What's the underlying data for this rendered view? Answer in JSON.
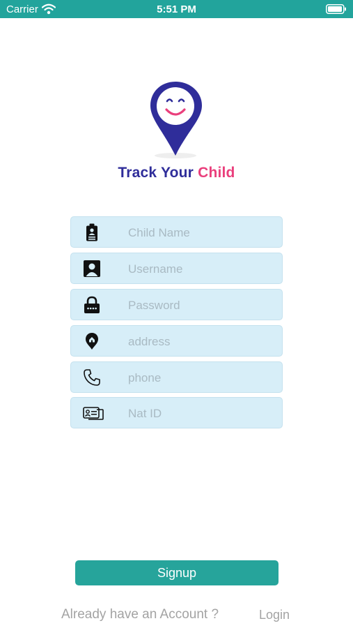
{
  "status_bar": {
    "carrier": "Carrier",
    "time": "5:51 PM",
    "icons": [
      "wifi-icon",
      "battery-icon"
    ]
  },
  "brand": {
    "title_part1": "Track Your",
    "title_part2": "Child",
    "colors": {
      "primary": "#2f2d9a",
      "accent": "#ea3f7c"
    }
  },
  "form": {
    "fields": [
      {
        "icon": "id-badge-icon",
        "placeholder": "Child Name",
        "value": ""
      },
      {
        "icon": "user-icon",
        "placeholder": "Username",
        "value": ""
      },
      {
        "icon": "lock-icon",
        "placeholder": "Password",
        "value": ""
      },
      {
        "icon": "home-pin-icon",
        "placeholder": "address",
        "value": ""
      },
      {
        "icon": "phone-icon",
        "placeholder": "phone",
        "value": ""
      },
      {
        "icon": "id-card-icon",
        "placeholder": "Nat ID",
        "value": ""
      }
    ]
  },
  "actions": {
    "signup_label": "Signup",
    "already_text": "Already have an Account ?",
    "login_label": "Login"
  },
  "theme": {
    "teal": "#22a49c",
    "field_bg": "#d7eef8",
    "placeholder": "#a9bac3"
  }
}
